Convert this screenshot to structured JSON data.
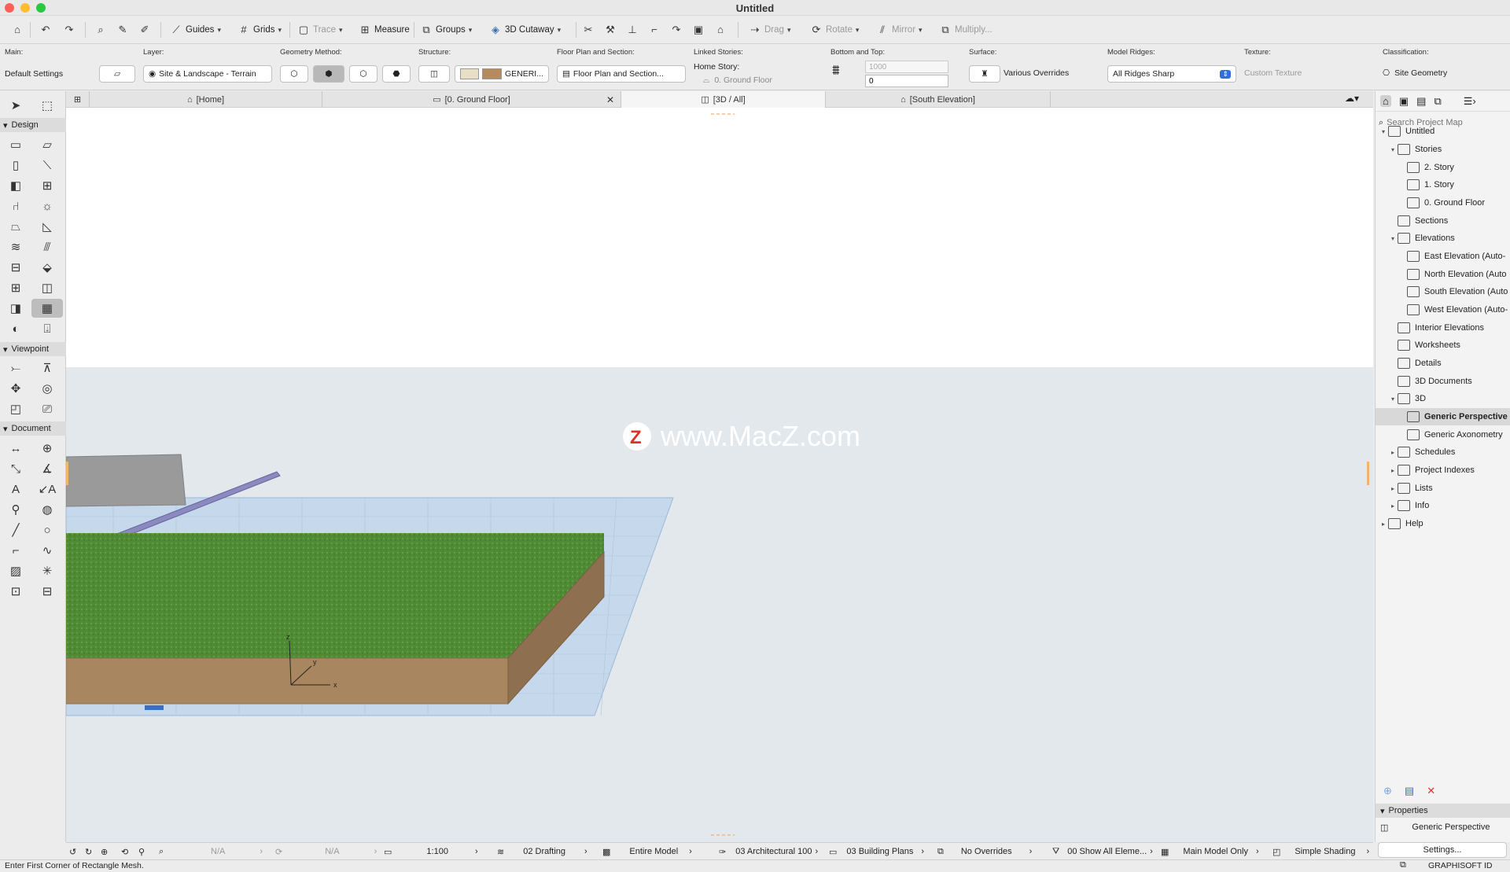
{
  "window": {
    "title": "Untitled"
  },
  "toolbar": {
    "guides": "Guides",
    "grids": "Grids",
    "trace": "Trace",
    "measure": "Measure",
    "groups": "Groups",
    "cutaway": "3D Cutaway",
    "drag": "Drag",
    "rotate": "Rotate",
    "mirror": "Mirror",
    "multiply": "Multiply..."
  },
  "infobox": {
    "main_label": "Main:",
    "main_value": "Default Settings",
    "layer_label": "Layer:",
    "layer_value": "Site & Landscape - Terrain",
    "geometry_label": "Geometry Method:",
    "structure_label": "Structure:",
    "structure_value": "GENERI...",
    "fps_label": "Floor Plan and Section:",
    "fps_value": "Floor Plan and Section...",
    "linked_label": "Linked Stories:",
    "home_story_label": "Home Story:",
    "home_story_value": "0. Ground Floor",
    "bt_label": "Bottom and Top:",
    "bt_top": "1000",
    "bt_bottom": "0",
    "surface_label": "Surface:",
    "surface_value": "Various Overrides",
    "ridges_label": "Model Ridges:",
    "ridges_value": "All Ridges Sharp",
    "texture_label": "Texture:",
    "texture_value": "Custom Texture",
    "class_label": "Classification:",
    "class_value": "Site Geometry"
  },
  "tabs": [
    {
      "label": "[Home]"
    },
    {
      "label": "[0. Ground Floor]"
    },
    {
      "label": "[3D / All]"
    },
    {
      "label": "[South Elevation]"
    }
  ],
  "toolbox": {
    "design": "Design",
    "viewpoint": "Viewpoint",
    "document": "Document"
  },
  "viewport": {
    "watermark": "www.MacZ.com",
    "axis_x": "x",
    "axis_y": "y",
    "axis_z": "z"
  },
  "navigator": {
    "search_placeholder": "Search Project Map",
    "items": [
      {
        "label": "Untitled"
      },
      {
        "label": "Stories"
      },
      {
        "label": "2. Story"
      },
      {
        "label": "1. Story"
      },
      {
        "label": "0. Ground Floor"
      },
      {
        "label": "Sections"
      },
      {
        "label": "Elevations"
      },
      {
        "label": "East Elevation (Auto-"
      },
      {
        "label": "North Elevation (Auto"
      },
      {
        "label": "South Elevation (Auto"
      },
      {
        "label": "West Elevation (Auto-"
      },
      {
        "label": "Interior Elevations"
      },
      {
        "label": "Worksheets"
      },
      {
        "label": "Details"
      },
      {
        "label": "3D Documents"
      },
      {
        "label": "3D"
      },
      {
        "label": "Generic Perspective"
      },
      {
        "label": "Generic Axonometry"
      },
      {
        "label": "Schedules"
      },
      {
        "label": "Project Indexes"
      },
      {
        "label": "Lists"
      },
      {
        "label": "Info"
      },
      {
        "label": "Help"
      }
    ],
    "properties_label": "Properties",
    "properties_value": "Generic Perspective",
    "settings_button": "Settings..."
  },
  "statusbar": {
    "na1": "N/A",
    "na2": "N/A",
    "scale": "1:100",
    "layer_combo": "02 Drafting",
    "model": "Entire Model",
    "pen_set": "03 Architectural 100",
    "mvo": "03 Building Plans",
    "overrides": "No Overrides",
    "renovation": "00 Show All Eleme...",
    "structure_display": "Main Model Only",
    "shading": "Simple Shading"
  },
  "bottom": {
    "prompt": "Enter First Corner of Rectangle Mesh.",
    "brand": "GRAPHISOFT ID"
  }
}
